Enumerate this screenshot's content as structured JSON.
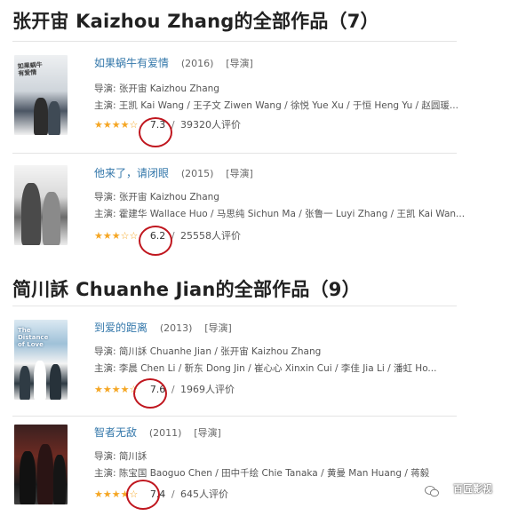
{
  "sections": [
    {
      "title": "张开宙 Kaizhou Zhang的全部作品（7）",
      "works": [
        {
          "poster_text": "如果蜗牛\n有爱情",
          "title": "如果蜗牛有爱情",
          "year": "(2016)",
          "role": "[导演]",
          "director": "导演: 张开宙 Kaizhou Zhang",
          "cast": "主演: 王凯 Kai Wang / 王子文 Ziwen Wang / 徐悦 Yue Xu / 于恒 Heng Yu / 赵圆瑗...",
          "stars": "★★★★☆",
          "score": "7.3",
          "sep": "/",
          "ratings": "39320人评价"
        },
        {
          "poster_text": "",
          "title": "他来了，请闭眼",
          "year": "(2015)",
          "role": "[导演]",
          "director": "导演: 张开宙 Kaizhou Zhang",
          "cast": "主演: 霍建华 Wallace Huo / 马思纯 Sichun Ma / 张鲁一 Luyi Zhang / 王凯 Kai Wan...",
          "stars": "★★★☆☆",
          "score": "6.2",
          "sep": "/",
          "ratings": "25558人评价"
        }
      ]
    },
    {
      "title": "简川訸 Chuanhe Jian的全部作品（9）",
      "works": [
        {
          "poster_text": "The\nDistance\nof Love",
          "title": "到爱的距离",
          "year": "(2013)",
          "role": "[导演]",
          "director": "导演: 简川訸 Chuanhe Jian / 张开宙 Kaizhou Zhang",
          "cast": "主演: 李晨 Chen Li / 靳东 Dong Jin / 崔心心 Xinxin Cui / 李佳 Jia Li / 潘虹 Ho...",
          "stars": "★★★★☆",
          "score": "7.6",
          "sep": "/",
          "ratings": "1969人评价"
        },
        {
          "poster_text": "",
          "title": "智者无敌",
          "year": "(2011)",
          "role": "[导演]",
          "director": "导演: 简川訸",
          "cast": "主演: 陈宝国 Baoguo Chen / 田中千绘 Chie Tanaka / 黄曼 Man Huang / 蒋毅 Yi Ma...",
          "stars": "★★★★☆",
          "score": "7.4",
          "sep": "/",
          "ratings": "645人评价"
        }
      ]
    }
  ],
  "watermark": "百匠影视",
  "colors": {
    "link": "#3377aa",
    "star": "#f5a623",
    "highlight_circle": "#c0171f"
  }
}
